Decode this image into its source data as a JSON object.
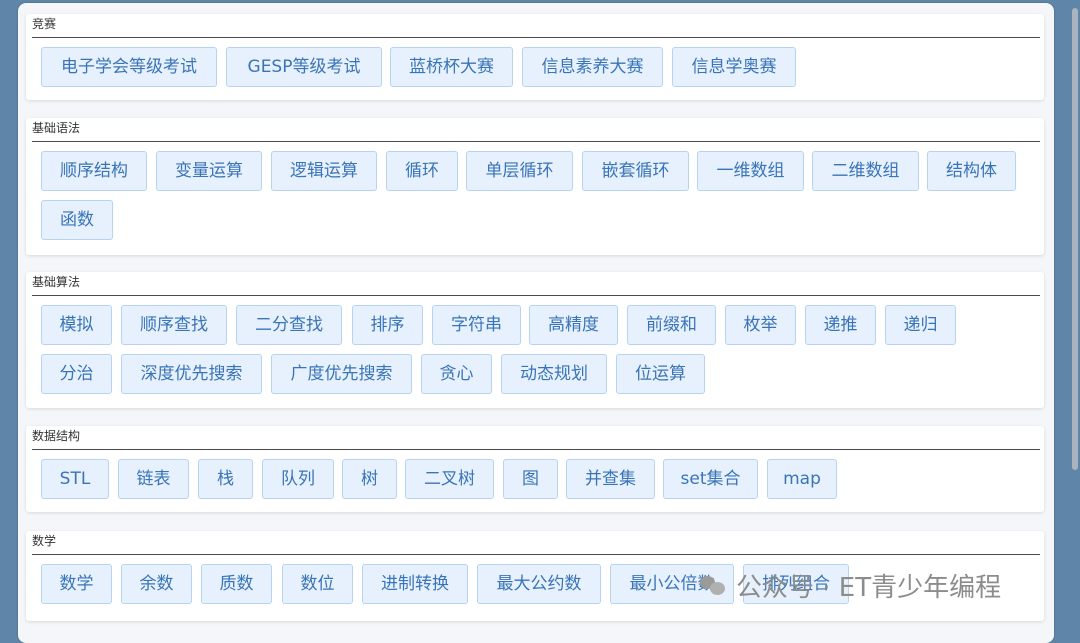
{
  "sections": [
    {
      "title": "竞赛",
      "chips": [
        "电子学会等级考试",
        "GESP等级考试",
        "蓝桥杯大赛",
        "信息素养大赛",
        "信息学奥赛"
      ]
    },
    {
      "title": "基础语法",
      "chips": [
        "顺序结构",
        "变量运算",
        "逻辑运算",
        "循环",
        "单层循环",
        "嵌套循环",
        "一维数组",
        "二维数组",
        "结构体",
        "函数"
      ]
    },
    {
      "title": "基础算法",
      "chips": [
        "模拟",
        "顺序查找",
        "二分查找",
        "排序",
        "字符串",
        "高精度",
        "前缀和",
        "枚举",
        "递推",
        "递归",
        "分治",
        "深度优先搜索",
        "广度优先搜索",
        "贪心",
        "动态规划",
        "位运算"
      ]
    },
    {
      "title": "数据结构",
      "chips": [
        "STL",
        "链表",
        "栈",
        "队列",
        "树",
        "二叉树",
        "图",
        "并查集",
        "set集合",
        "map"
      ]
    },
    {
      "title": "数学",
      "chips": [
        "数学",
        "余数",
        "质数",
        "数位",
        "进制转换",
        "最大公约数",
        "最小公倍数",
        "排列组合"
      ]
    }
  ],
  "watermark": {
    "text": "公众号 · ET青少年编程",
    "icon": "wechat-logo-icon"
  }
}
